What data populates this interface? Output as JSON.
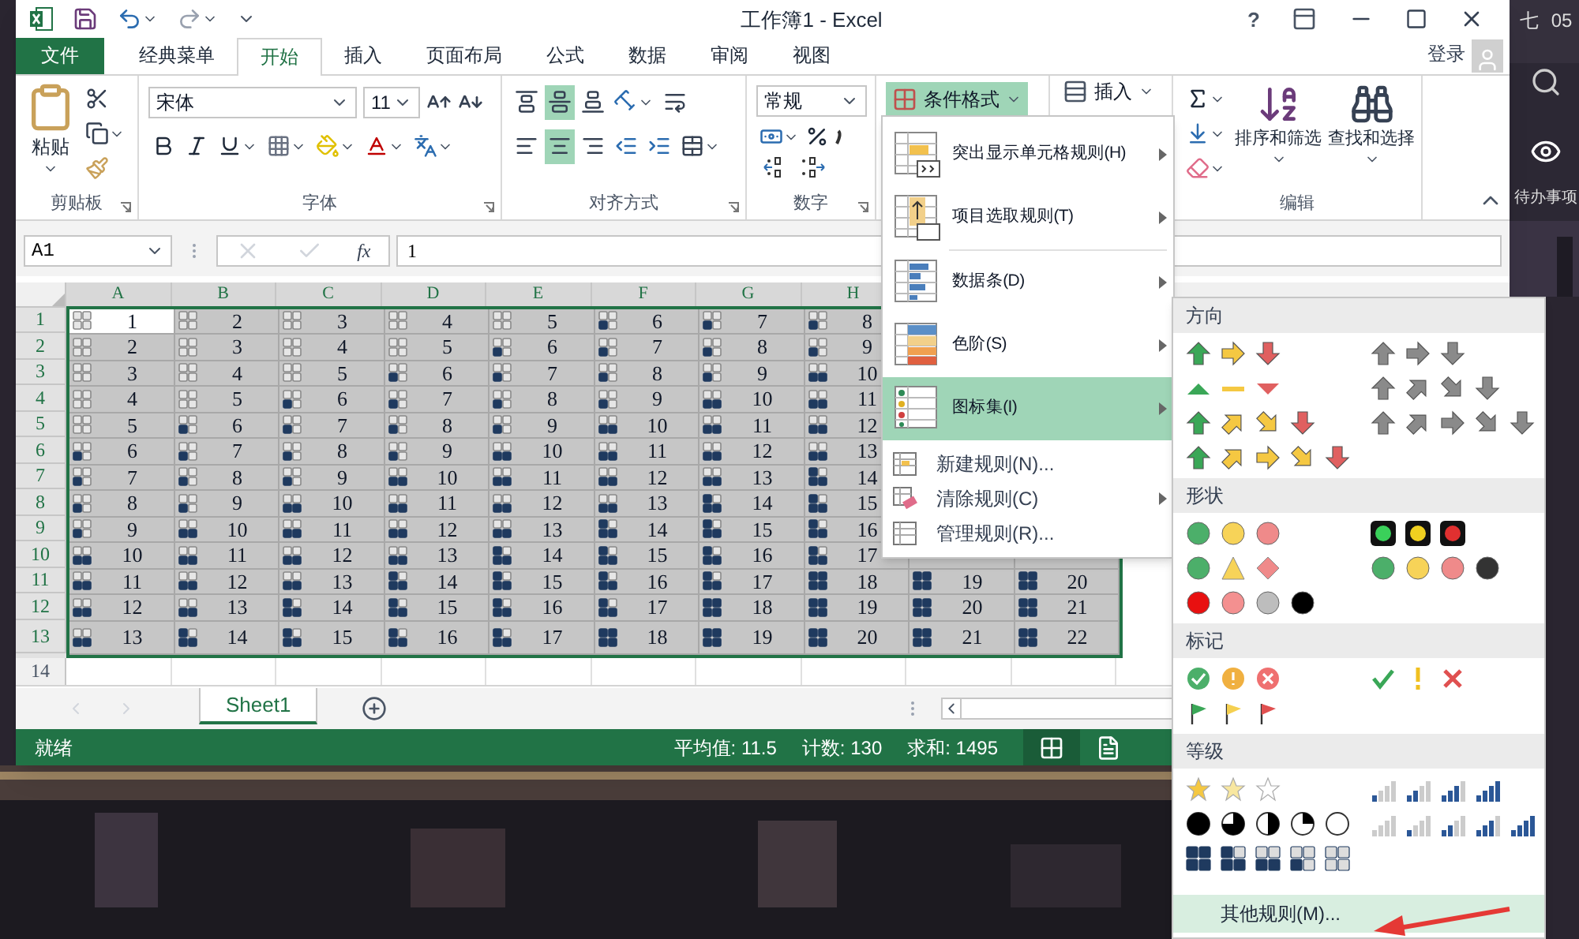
{
  "desktop": {
    "clock_fragments": [
      "七",
      "05"
    ],
    "side_label": "待办事项"
  },
  "window": {
    "title": "工作簿1 - Excel",
    "help_label": "?",
    "login": "登录"
  },
  "ribbon_tabs": [
    {
      "label": "文件",
      "kind": "file",
      "selected": false
    },
    {
      "label": "经典菜单",
      "kind": "tab",
      "selected": false
    },
    {
      "label": "开始",
      "kind": "tab",
      "selected": true
    },
    {
      "label": "插入",
      "kind": "tab",
      "selected": false
    },
    {
      "label": "页面布局",
      "kind": "tab",
      "selected": false
    },
    {
      "label": "公式",
      "kind": "tab",
      "selected": false
    },
    {
      "label": "数据",
      "kind": "tab",
      "selected": false
    },
    {
      "label": "审阅",
      "kind": "tab",
      "selected": false
    },
    {
      "label": "视图",
      "kind": "tab",
      "selected": false
    }
  ],
  "ribbon": {
    "clipboard": {
      "label": "剪贴板",
      "paste": "粘贴"
    },
    "font": {
      "label": "字体",
      "font_name": "宋体",
      "font_size": "11"
    },
    "alignment": {
      "label": "对齐方式",
      "vertical": [
        {
          "kind": "top",
          "selected": false
        },
        {
          "kind": "middle",
          "selected": true
        },
        {
          "kind": "bottom",
          "selected": false
        }
      ],
      "horizontal": [
        {
          "kind": "left",
          "selected": false
        },
        {
          "kind": "center",
          "selected": true
        },
        {
          "kind": "right",
          "selected": false
        }
      ]
    },
    "number": {
      "label": "数字",
      "format": "常规"
    },
    "conditional_format": {
      "label": "条件格式",
      "pressed": true
    },
    "insert": {
      "label": "插入"
    },
    "editing": {
      "label": "编辑",
      "sort": "排序和筛选",
      "find": "查找和选择"
    }
  },
  "formula_bar": {
    "name_box": "A1",
    "function_label": "fx",
    "value": "1"
  },
  "sheet": {
    "columns": [
      "A",
      "B",
      "C",
      "D",
      "E",
      "F",
      "G",
      "H"
    ],
    "rows": [
      {
        "number": "1",
        "cells": [
          {
            "value": "1",
            "kind": "empty",
            "active": true
          },
          {
            "value": "2",
            "kind": "empty",
            "active": false
          },
          {
            "value": "3",
            "kind": "empty",
            "active": false
          },
          {
            "value": "4",
            "kind": "empty",
            "active": false
          },
          {
            "value": "5",
            "kind": "empty",
            "active": false
          },
          {
            "value": "6",
            "kind": "quarter",
            "active": false
          },
          {
            "value": "7",
            "kind": "quarter",
            "active": false
          },
          {
            "value": "8",
            "kind": "quarter",
            "active": false
          }
        ]
      },
      {
        "number": "2",
        "cells": [
          {
            "value": "2",
            "kind": "empty",
            "active": false
          },
          {
            "value": "3",
            "kind": "empty",
            "active": false
          },
          {
            "value": "4",
            "kind": "empty",
            "active": false
          },
          {
            "value": "5",
            "kind": "empty",
            "active": false
          },
          {
            "value": "6",
            "kind": "quarter",
            "active": false
          },
          {
            "value": "7",
            "kind": "quarter",
            "active": false
          },
          {
            "value": "8",
            "kind": "quarter",
            "active": false
          },
          {
            "value": "9",
            "kind": "quarter",
            "active": false
          }
        ]
      },
      {
        "number": "3",
        "cells": [
          {
            "value": "3",
            "kind": "empty",
            "active": false
          },
          {
            "value": "4",
            "kind": "empty",
            "active": false
          },
          {
            "value": "5",
            "kind": "empty",
            "active": false
          },
          {
            "value": "6",
            "kind": "quarter",
            "active": false
          },
          {
            "value": "7",
            "kind": "quarter",
            "active": false
          },
          {
            "value": "8",
            "kind": "quarter",
            "active": false
          },
          {
            "value": "9",
            "kind": "quarter",
            "active": false
          },
          {
            "value": "10",
            "kind": "half",
            "active": false
          }
        ]
      },
      {
        "number": "4",
        "cells": [
          {
            "value": "4",
            "kind": "empty",
            "active": false
          },
          {
            "value": "5",
            "kind": "empty",
            "active": false
          },
          {
            "value": "6",
            "kind": "quarter",
            "active": false
          },
          {
            "value": "7",
            "kind": "quarter",
            "active": false
          },
          {
            "value": "8",
            "kind": "quarter",
            "active": false
          },
          {
            "value": "9",
            "kind": "quarter",
            "active": false
          },
          {
            "value": "10",
            "kind": "half",
            "active": false
          },
          {
            "value": "11",
            "kind": "half",
            "active": false
          }
        ]
      },
      {
        "number": "5",
        "cells": [
          {
            "value": "5",
            "kind": "empty",
            "active": false
          },
          {
            "value": "6",
            "kind": "quarter",
            "active": false
          },
          {
            "value": "7",
            "kind": "quarter",
            "active": false
          },
          {
            "value": "8",
            "kind": "quarter",
            "active": false
          },
          {
            "value": "9",
            "kind": "quarter",
            "active": false
          },
          {
            "value": "10",
            "kind": "half",
            "active": false
          },
          {
            "value": "11",
            "kind": "half",
            "active": false
          },
          {
            "value": "12",
            "kind": "half",
            "active": false
          }
        ]
      },
      {
        "number": "6",
        "cells": [
          {
            "value": "6",
            "kind": "quarter",
            "active": false
          },
          {
            "value": "7",
            "kind": "quarter",
            "active": false
          },
          {
            "value": "8",
            "kind": "quarter",
            "active": false
          },
          {
            "value": "9",
            "kind": "quarter",
            "active": false
          },
          {
            "value": "10",
            "kind": "half",
            "active": false
          },
          {
            "value": "11",
            "kind": "half",
            "active": false
          },
          {
            "value": "12",
            "kind": "half",
            "active": false
          },
          {
            "value": "13",
            "kind": "half",
            "active": false
          }
        ]
      },
      {
        "number": "7",
        "cells": [
          {
            "value": "7",
            "kind": "quarter",
            "active": false
          },
          {
            "value": "8",
            "kind": "quarter",
            "active": false
          },
          {
            "value": "9",
            "kind": "quarter",
            "active": false
          },
          {
            "value": "10",
            "kind": "half",
            "active": false
          },
          {
            "value": "11",
            "kind": "half",
            "active": false
          },
          {
            "value": "12",
            "kind": "half",
            "active": false
          },
          {
            "value": "13",
            "kind": "half",
            "active": false
          },
          {
            "value": "14",
            "kind": "three-quarters",
            "active": false
          }
        ]
      },
      {
        "number": "8",
        "cells": [
          {
            "value": "8",
            "kind": "quarter",
            "active": false
          },
          {
            "value": "9",
            "kind": "quarter",
            "active": false
          },
          {
            "value": "10",
            "kind": "half",
            "active": false
          },
          {
            "value": "11",
            "kind": "half",
            "active": false
          },
          {
            "value": "12",
            "kind": "half",
            "active": false
          },
          {
            "value": "13",
            "kind": "half",
            "active": false
          },
          {
            "value": "14",
            "kind": "three-quarters",
            "active": false
          },
          {
            "value": "15",
            "kind": "three-quarters",
            "active": false
          }
        ]
      },
      {
        "number": "9",
        "cells": [
          {
            "value": "9",
            "kind": "quarter",
            "active": false
          },
          {
            "value": "10",
            "kind": "half",
            "active": false
          },
          {
            "value": "11",
            "kind": "half",
            "active": false
          },
          {
            "value": "12",
            "kind": "half",
            "active": false
          },
          {
            "value": "13",
            "kind": "half",
            "active": false
          },
          {
            "value": "14",
            "kind": "three-quarters",
            "active": false
          },
          {
            "value": "15",
            "kind": "three-quarters",
            "active": false
          },
          {
            "value": "16",
            "kind": "three-quarters",
            "active": false
          }
        ]
      },
      {
        "number": "10",
        "cells": [
          {
            "value": "10",
            "kind": "half",
            "active": false
          },
          {
            "value": "11",
            "kind": "half",
            "active": false
          },
          {
            "value": "12",
            "kind": "half",
            "active": false
          },
          {
            "value": "13",
            "kind": "half",
            "active": false
          },
          {
            "value": "14",
            "kind": "three-quarters",
            "active": false
          },
          {
            "value": "15",
            "kind": "three-quarters",
            "active": false
          },
          {
            "value": "16",
            "kind": "three-quarters",
            "active": false
          },
          {
            "value": "17",
            "kind": "three-quarters",
            "active": false
          }
        ]
      },
      {
        "number": "11",
        "cells": [
          {
            "value": "11",
            "kind": "half",
            "active": false
          },
          {
            "value": "12",
            "kind": "half",
            "active": false
          },
          {
            "value": "13",
            "kind": "half",
            "active": false
          },
          {
            "value": "14",
            "kind": "three-quarters",
            "active": false
          },
          {
            "value": "15",
            "kind": "three-quarters",
            "active": false
          },
          {
            "value": "16",
            "kind": "three-quarters",
            "active": false
          },
          {
            "value": "17",
            "kind": "three-quarters",
            "active": false
          },
          {
            "value": "18",
            "kind": "full",
            "active": false
          },
          {
            "value": "19",
            "kind": "full",
            "active": false
          },
          {
            "value": "20",
            "kind": "full",
            "active": false
          }
        ]
      },
      {
        "number": "12",
        "cells": [
          {
            "value": "12",
            "kind": "half",
            "active": false
          },
          {
            "value": "13",
            "kind": "half",
            "active": false
          },
          {
            "value": "14",
            "kind": "three-quarters",
            "active": false
          },
          {
            "value": "15",
            "kind": "three-quarters",
            "active": false
          },
          {
            "value": "16",
            "kind": "three-quarters",
            "active": false
          },
          {
            "value": "17",
            "kind": "three-quarters",
            "active": false
          },
          {
            "value": "18",
            "kind": "full",
            "active": false
          },
          {
            "value": "19",
            "kind": "full",
            "active": false
          },
          {
            "value": "20",
            "kind": "full",
            "active": false
          },
          {
            "value": "21",
            "kind": "full",
            "active": false
          }
        ]
      },
      {
        "number": "13",
        "cells": [
          {
            "value": "13",
            "kind": "half",
            "active": false
          },
          {
            "value": "14",
            "kind": "three-quarters",
            "active": false
          },
          {
            "value": "15",
            "kind": "three-quarters",
            "active": false
          },
          {
            "value": "16",
            "kind": "three-quarters",
            "active": false
          },
          {
            "value": "17",
            "kind": "three-quarters",
            "active": false
          },
          {
            "value": "18",
            "kind": "full",
            "active": false
          },
          {
            "value": "19",
            "kind": "full",
            "active": false
          },
          {
            "value": "20",
            "kind": "full",
            "active": false
          },
          {
            "value": "21",
            "kind": "full",
            "active": false
          },
          {
            "value": "22",
            "kind": "full",
            "active": false
          }
        ]
      }
    ],
    "empty_row": "14"
  },
  "sheet_tabs": [
    {
      "label": "Sheet1",
      "selected": true
    }
  ],
  "status_bar": {
    "state": "就绪",
    "average": "平均值: 11.5",
    "count": "计数: 130",
    "sum": "求和: 1495",
    "views": [
      {
        "kind": "normal",
        "selected": true
      },
      {
        "kind": "page-layout",
        "selected": false
      }
    ]
  },
  "conditional_menu": [
    {
      "label": "突出显示单元格规则(H)",
      "kind": "highlight",
      "submenu": true,
      "highlighted": false
    },
    {
      "label": "项目选取规则(T)",
      "kind": "top",
      "submenu": true,
      "highlighted": false
    },
    {
      "label": "数据条(D)",
      "kind": "databar",
      "submenu": true,
      "highlighted": false
    },
    {
      "label": "色阶(S)",
      "kind": "colorscale",
      "submenu": true,
      "highlighted": false
    },
    {
      "label": "图标集(I)",
      "kind": "iconset",
      "submenu": true,
      "highlighted": true
    },
    {
      "label": "新建规则(N)...",
      "kind": "new",
      "submenu": false,
      "highlighted": false
    },
    {
      "label": "清除规则(C)",
      "kind": "clear",
      "submenu": true,
      "highlighted": false
    },
    {
      "label": "管理规则(R)...",
      "kind": "manage",
      "submenu": false,
      "highlighted": false
    }
  ],
  "icon_set_menu": {
    "sections": [
      {
        "title": "方向",
        "sets": [
          {
            "kind": "arrows3"
          },
          {
            "kind": "arrows3-gray"
          },
          {
            "kind": "triangles3"
          },
          {
            "kind": "arrows4-gray"
          },
          {
            "kind": "arrows4"
          },
          {
            "kind": "arrows5-gray"
          },
          {
            "kind": "arrows5"
          }
        ]
      },
      {
        "title": "形状",
        "sets": [
          {
            "kind": "circles3"
          },
          {
            "kind": "traffic3-rimmed"
          },
          {
            "kind": "signs3"
          },
          {
            "kind": "traffic4"
          },
          {
            "kind": "red-black"
          }
        ]
      },
      {
        "title": "标记",
        "sets": [
          {
            "kind": "symbols3-circled"
          },
          {
            "kind": "symbols3"
          },
          {
            "kind": "flags3"
          }
        ]
      },
      {
        "title": "等级",
        "sets": [
          {
            "kind": "stars3"
          },
          {
            "kind": "ratings4"
          },
          {
            "kind": "quarters5"
          },
          {
            "kind": "ratings5"
          },
          {
            "kind": "boxes5"
          }
        ]
      }
    ],
    "more": {
      "label": "其他规则(M)...",
      "highlighted": true
    }
  }
}
